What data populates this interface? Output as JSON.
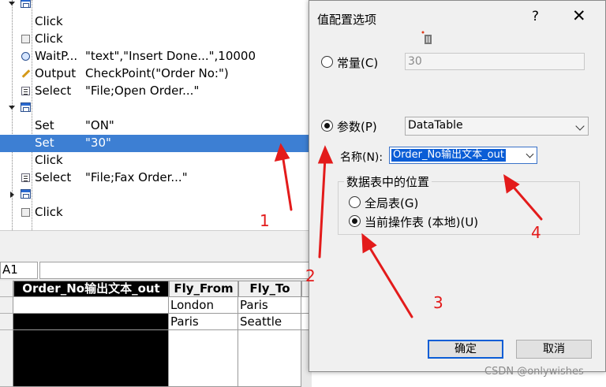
{
  "tree": {
    "rows": [
      {
        "kind": "container",
        "expander": "down",
        "icon": "window-icon",
        "item": "",
        "value": ""
      },
      {
        "kind": "step",
        "icon": "",
        "item": "Click",
        "value": ""
      },
      {
        "kind": "step",
        "icon": "checkbox-icon",
        "item": "Click",
        "value": ""
      },
      {
        "kind": "step",
        "icon": "clock-icon",
        "item": "WaitP...",
        "value": "\"text\",\"Insert Done...\",10000"
      },
      {
        "kind": "step",
        "icon": "pencil-icon",
        "item": "Output",
        "value": "CheckPoint(\"Order No:\")"
      },
      {
        "kind": "step",
        "icon": "list-icon",
        "item": "Select",
        "value": "\"File;Open Order...\""
      },
      {
        "kind": "container",
        "expander": "down",
        "icon": "window-icon",
        "item": "",
        "value": ""
      },
      {
        "kind": "step",
        "icon": "",
        "item": "Set",
        "value": "\"ON\""
      },
      {
        "kind": "step",
        "icon": "",
        "item": "Set",
        "value": "\"30\"",
        "selected": true
      },
      {
        "kind": "step",
        "icon": "",
        "item": "Click",
        "value": ""
      },
      {
        "kind": "step",
        "icon": "list-icon",
        "item": "Select",
        "value": "\"File;Fax Order...\""
      },
      {
        "kind": "container",
        "expander": "right",
        "icon": "window-icon",
        "item": "",
        "value": ""
      },
      {
        "kind": "step",
        "icon": "checkbox-icon",
        "item": "Click",
        "value": ""
      }
    ]
  },
  "formula_bar": {
    "cell_ref": "A1",
    "value": ""
  },
  "grid": {
    "headers": [
      "Order_No输出文本_out",
      "Fly_From",
      "Fly_To"
    ],
    "rows": [
      [
        "",
        "London",
        "Paris"
      ],
      [
        "",
        "Paris",
        "Seattle"
      ]
    ]
  },
  "dialog": {
    "title": "值配置选项",
    "help": "?",
    "close": "✕",
    "constant_label": "常量(C)",
    "constant_value": "30",
    "parameter_label": "参数(P)",
    "parameter_type": "DataTable",
    "name_label": "名称(N):",
    "name_value": "Order_No输出文本_out",
    "location_group": "数据表中的位置",
    "global_label": "全局表(G)",
    "local_label": "当前操作表 (本地)(U)",
    "ok_label": "确定",
    "cancel_label": "取消"
  },
  "annotations": {
    "a1": "1",
    "a2": "2",
    "a3": "3",
    "a4": "4",
    "color": "#e31b1b"
  },
  "watermark": "CSDN @onlywishes"
}
